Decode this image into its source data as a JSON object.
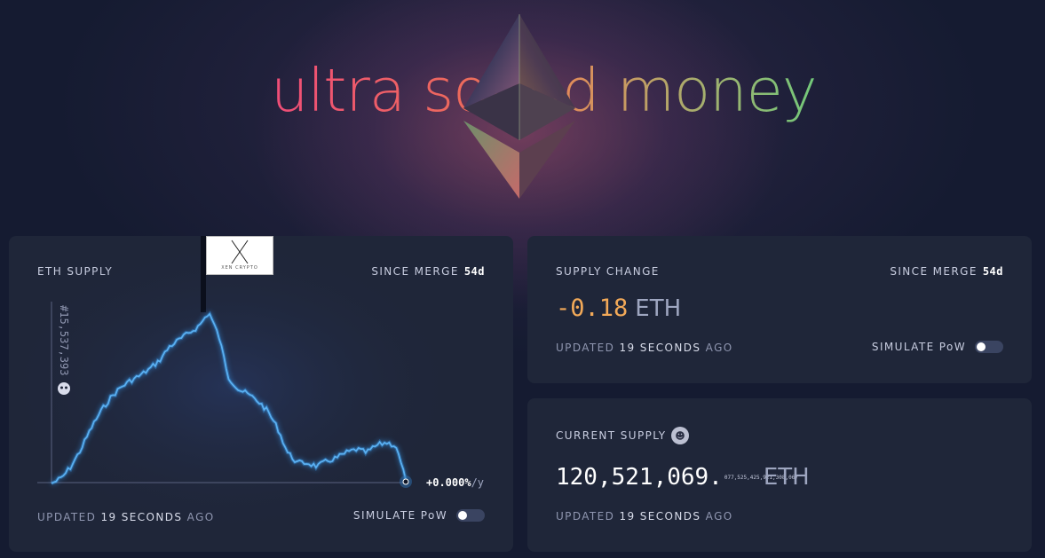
{
  "hero": {
    "title": "ultra sound money",
    "logo_icon": "ethereum-icon"
  },
  "eth_supply_card": {
    "label": "ETH SUPPLY",
    "since_label": "SINCE MERGE",
    "since_value": "54d",
    "block_label": "#15,537,393",
    "flag_text": "XEN CRYPTO",
    "end_rate_value": "+0.000%",
    "end_rate_unit": "/y",
    "updated_prefix": "UPDATED",
    "updated_value": "19 SECONDS",
    "updated_suffix": "AGO",
    "simulate_label": "SIMULATE PoW",
    "colors": {
      "line": "#5ab0f2",
      "glow": "#3aa6ff"
    }
  },
  "supply_change_card": {
    "label": "SUPPLY CHANGE",
    "since_label": "SINCE MERGE",
    "since_value": "54d",
    "value": "-0.18",
    "unit": "ETH",
    "updated_prefix": "UPDATED",
    "updated_value": "19 SECONDS",
    "updated_suffix": "AGO",
    "simulate_label": "SIMULATE PoW",
    "colors": {
      "value": "#f2a958"
    }
  },
  "current_supply_card": {
    "label": "CURRENT SUPPLY",
    "icon": "nerd-face-icon",
    "value_main": "120,521,069.",
    "value_decimals": "077,525,425,921,308,067",
    "unit": "ETH",
    "updated_prefix": "UPDATED",
    "updated_value": "19 SECONDS",
    "updated_suffix": "AGO"
  },
  "chart_data": {
    "type": "line",
    "title": "ETH SUPPLY",
    "annotations": [
      "#15,537,393",
      "XEN CRYPTO",
      "+0.000%/y"
    ],
    "x_label": "",
    "y_label": "",
    "series": [
      {
        "values": [
          0,
          0.03,
          0.1,
          0.2,
          0.32,
          0.42,
          0.5,
          0.56,
          0.6,
          0.63,
          0.67,
          0.72,
          0.8,
          0.84,
          0.88,
          0.92,
          1.0,
          0.86,
          0.62,
          0.55,
          0.52,
          0.48,
          0.42,
          0.32,
          0.18,
          0.12,
          0.12,
          0.1,
          0.13,
          0.15,
          0.18,
          0.2,
          0.18,
          0.22,
          0.24,
          0.22,
          0.02
        ]
      }
    ]
  }
}
